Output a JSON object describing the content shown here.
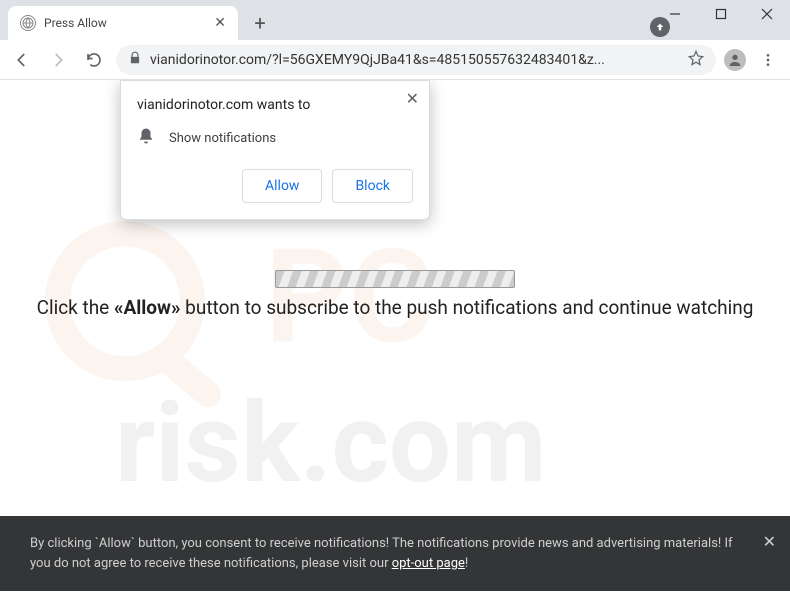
{
  "window": {
    "tab_title": "Press Allow",
    "url": "vianidorinotor.com/?l=56GXEMY9QjJBa41&s=485150557632483401&z..."
  },
  "permission": {
    "origin": "vianidorinotor.com wants to",
    "request": "Show notifications",
    "allow": "Allow",
    "block": "Block"
  },
  "page": {
    "instruction_pre": "Click the ",
    "instruction_bold": "«Allow»",
    "instruction_post": " button to subscribe to the push notifications and continue watching"
  },
  "footer": {
    "text_a": "By clicking `Allow` button, you consent to receive notifications! The notifications provide news and advertising materials! If you do not agree to receive these notifications, please visit our ",
    "link": "opt-out page",
    "text_b": "!"
  },
  "watermark": "PC risk.com"
}
